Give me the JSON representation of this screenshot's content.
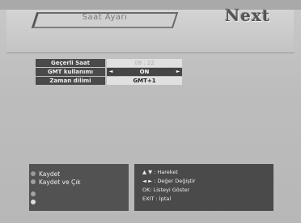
{
  "header": {
    "title": "Saat Ayarı",
    "brand": "Next"
  },
  "settings": [
    {
      "label": "Geçerli Saat",
      "value": "08 : 22"
    },
    {
      "label": "GMT kullanımı",
      "value": "ON"
    },
    {
      "label": "Zaman dilimi",
      "value": "GMT+1"
    }
  ],
  "legend": {
    "items": [
      {
        "label": "Kaydet",
        "color": "#9a9a9a"
      },
      {
        "label": "Kaydet ve Çık",
        "color": "#a0a0a0"
      },
      {
        "label": "",
        "color": "#a4a4a4"
      },
      {
        "label": "",
        "color": "#dcdcdc"
      }
    ]
  },
  "hints": [
    "▲ ▼ : Hareket",
    "◄ ► : Değer Değiştir",
    "OK: Listeyi Göster",
    "EXIT : İptal"
  ]
}
